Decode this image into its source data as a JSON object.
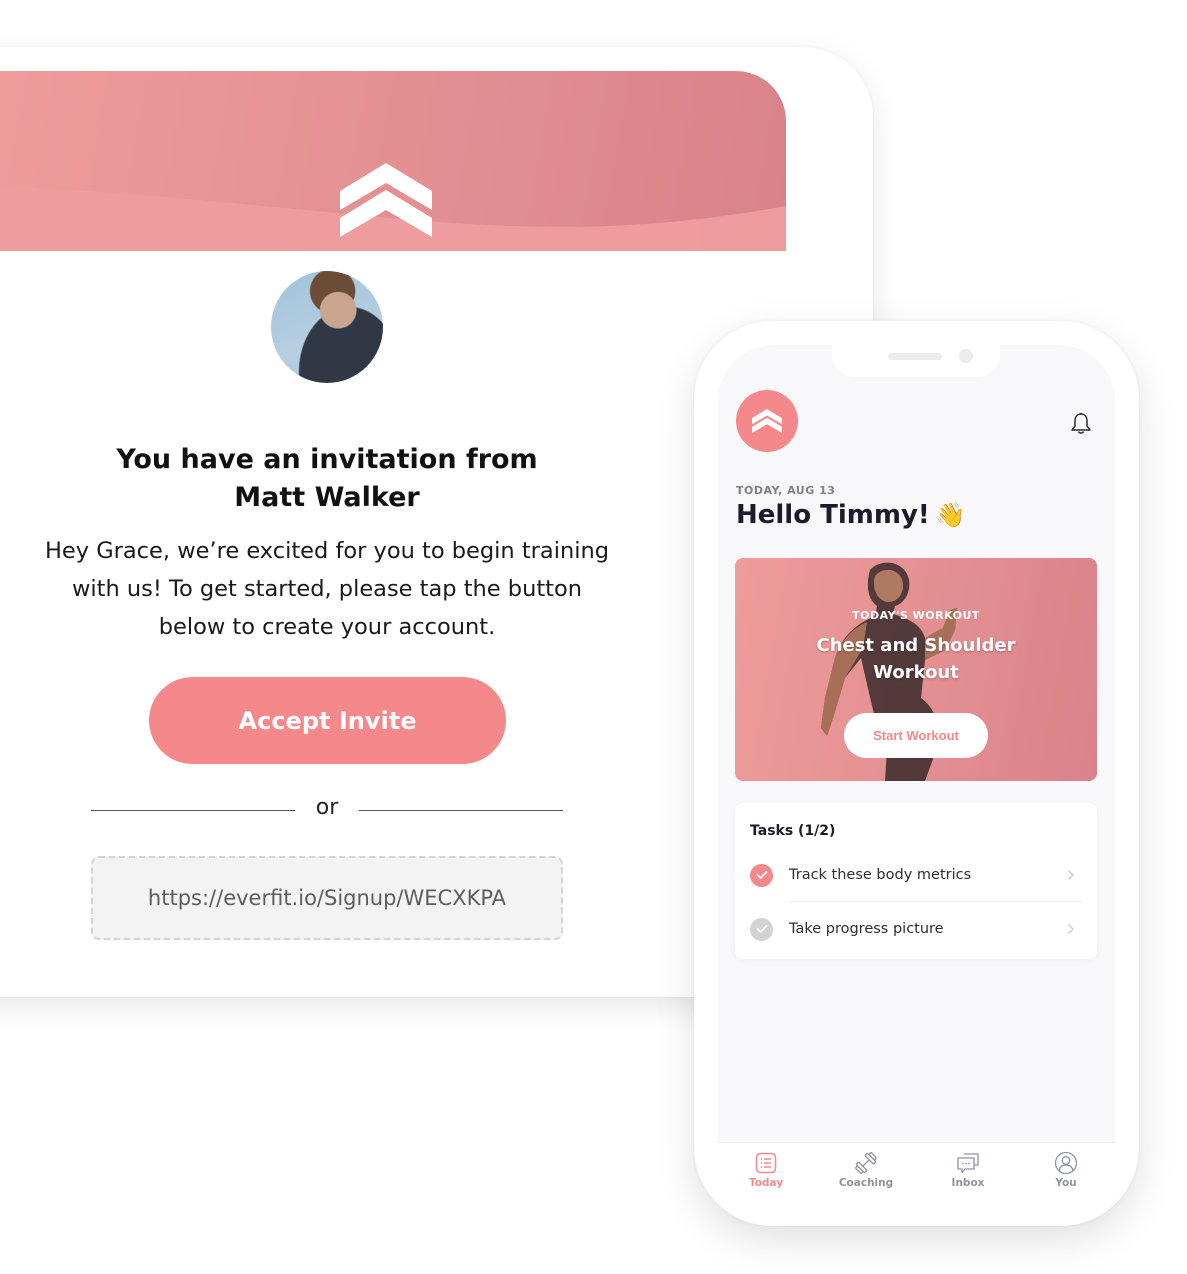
{
  "colors": {
    "brand": "#f4888a",
    "hero_gradient_start": "#ee9c9a",
    "hero_gradient_end": "#d9828a",
    "text_dark": "#111111",
    "muted": "#8f93a0"
  },
  "email": {
    "logo_icon": "double-chevron-up-icon",
    "avatar_alt": "Matt Walker profile photo",
    "title_line1": "You have an invitation from",
    "title_line2": "Matt Walker",
    "body_line1": "Hey Grace, we’re excited for you to begin training",
    "body_line2": "with us! To get started, please tap the button",
    "body_line3": "below to create your account.",
    "accept_button": "Accept Invite",
    "divider_text": "or",
    "signup_link": "https://everfit.io/Signup/WECXKPA"
  },
  "phone": {
    "logo_icon": "double-chevron-up-icon",
    "notification_icon": "bell-icon",
    "date_label": "TODAY, AUG 13",
    "greeting": "Hello Timmy!",
    "greeting_emoji": "👋",
    "workout": {
      "kicker": "TODAY'S WORKOUT",
      "title_line1": "Chest and Shoulder",
      "title_line2": "Workout",
      "start_button": "Start Workout"
    },
    "tasks": {
      "title": "Tasks (1/2)",
      "items": [
        {
          "label": "Track these body metrics",
          "done": true
        },
        {
          "label": "Take progress picture",
          "done": false
        }
      ]
    },
    "tabbar": [
      {
        "label": "Today",
        "icon": "list-icon",
        "active": true
      },
      {
        "label": "Coaching",
        "icon": "dumbbell-icon",
        "active": false
      },
      {
        "label": "Inbox",
        "icon": "chat-bubbles-icon",
        "active": false
      },
      {
        "label": "You",
        "icon": "user-icon",
        "active": false
      }
    ]
  }
}
